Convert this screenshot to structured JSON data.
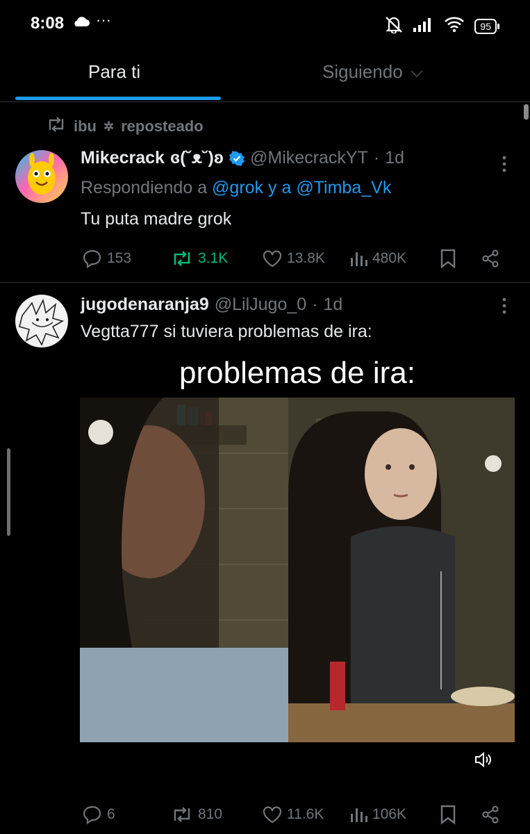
{
  "status_bar": {
    "time": "8:08",
    "more": "···",
    "battery": "95"
  },
  "tabs": [
    {
      "label": "Para ti"
    },
    {
      "label": "Siguiendo"
    }
  ],
  "repost_banner": {
    "user": "ibu",
    "action": "reposteado"
  },
  "tweet1": {
    "name": "Mikecrack",
    "name_suffix": "ɞ(˘ᴥ˘)ʚ",
    "handle": "@MikecrackYT",
    "separator": "·",
    "time": "1d",
    "replying_prefix": "Respondiendo a",
    "replying_user1": "@grok",
    "replying_and": "y a",
    "replying_user2": "@Timba_Vk",
    "text": "Tu puta madre grok",
    "replies": "153",
    "reposts": "3.1K",
    "likes": "13.8K",
    "views": "480K"
  },
  "tweet2": {
    "name": "jugodenaranja9",
    "handle": "@LilJugo_0",
    "separator": "·",
    "time": "1d",
    "text": "Vegtta777 si tuviera problemas de ira:",
    "media_caption": "problemas de ira:",
    "replies": "6",
    "reposts": "810",
    "likes": "11.6K",
    "views": "106K"
  },
  "colors": {
    "accent": "#1d9bf0",
    "repost_active": "#00ba7c",
    "muted": "#71767b",
    "background": "#000000"
  }
}
